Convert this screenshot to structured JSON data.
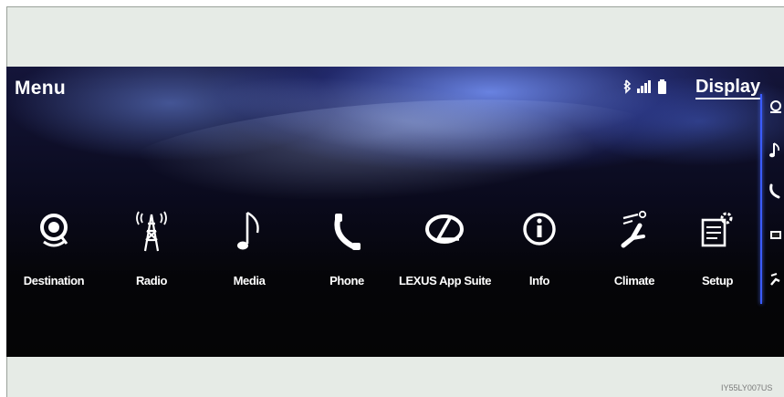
{
  "header": {
    "title": "Menu",
    "display_label": "Display"
  },
  "status_icons": [
    "bluetooth-icon",
    "signal-strength-icon",
    "battery-icon"
  ],
  "menu_items": [
    {
      "label": "Destination",
      "icon": "destination-icon"
    },
    {
      "label": "Radio",
      "icon": "radio-tower-icon"
    },
    {
      "label": "Media",
      "icon": "music-note-icon"
    },
    {
      "label": "Phone",
      "icon": "phone-icon"
    },
    {
      "label": "LEXUS App Suite",
      "icon": "lexus-logo-icon"
    },
    {
      "label": "Info",
      "icon": "info-icon"
    },
    {
      "label": "Climate",
      "icon": "climate-seat-icon"
    },
    {
      "label": "Setup",
      "icon": "setup-icon"
    }
  ],
  "side_shortcuts": [
    "navigation-icon",
    "music-note-icon",
    "phone-icon",
    "info-icon",
    "climate-seat-icon"
  ],
  "figure_code": "IY55LY007US",
  "colors": {
    "screen_top": "#14153a",
    "screen_bottom": "#050505",
    "accent_divider": "#3a5bff",
    "frame": "#e6ebe6"
  }
}
